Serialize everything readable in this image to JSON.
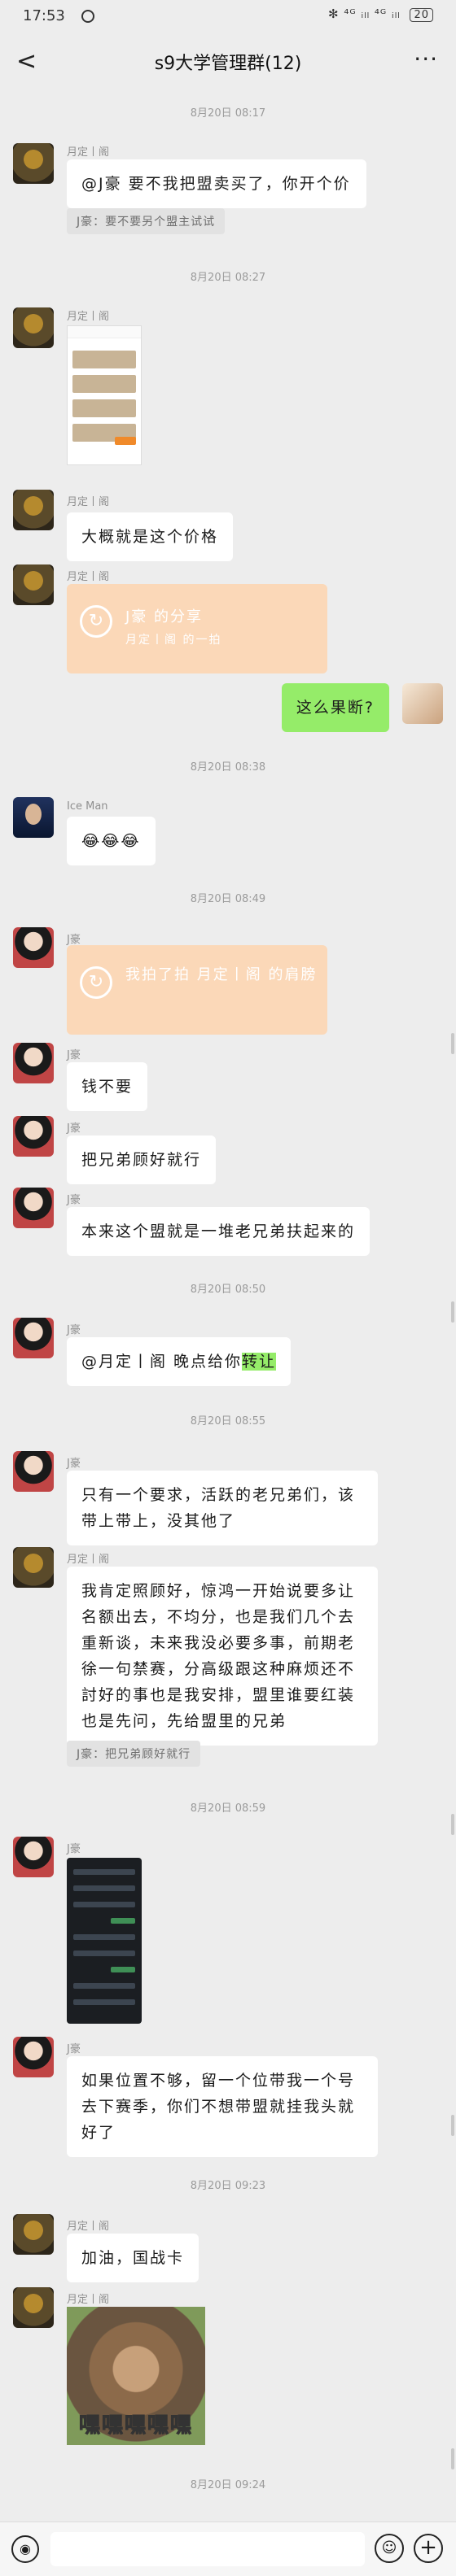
{
  "status": {
    "time": "17:53",
    "indicators": "✻ ⁴ᴳ ᵢₗₗ ⁴ᴳ ᵢₗₗ",
    "battery": "20"
  },
  "header": {
    "back": "<",
    "title": "s9大学管理群(12)",
    "more": "···"
  },
  "timestamps": [
    "8月20日 08:17",
    "8月20日 08:27",
    "8月20日 08:38",
    "8月20日 08:49",
    "8月20日 08:50",
    "8月20日 08:55",
    "8月20日 08:59",
    "8月20日 09:23",
    "8月20日 09:24"
  ],
  "messages": {
    "m1": {
      "nick": "月定丨阁",
      "text": "@J豪 要不我把盟卖买了，你开个价",
      "quote": "J豪：要不要另个盟主试试"
    },
    "m2": {
      "nick": "月定丨阁"
    },
    "m3": {
      "nick": "月定丨阁",
      "text": "大概就是这个价格"
    },
    "m4": {
      "nick": "月定丨阁",
      "card_title": "J豪 的分享",
      "card_sub": "月定丨阁 的一拍"
    },
    "m5": {
      "text": "这么果断?"
    },
    "m6": {
      "nick": "Ice Man",
      "text": "😂😂😂"
    },
    "m7": {
      "nick": "J豪",
      "card_title": "我拍了拍 月定丨阁 的肩膀"
    },
    "m8": {
      "nick": "J豪",
      "text": "钱不要"
    },
    "m9": {
      "nick": "J豪",
      "text": "把兄弟顾好就行"
    },
    "m10": {
      "nick": "J豪",
      "text": "本来这个盟就是一堆老兄弟扶起来的"
    },
    "m11": {
      "nick": "J豪",
      "text_a": "@月定丨阁 晚点给你",
      "text_b": "转让"
    },
    "m12": {
      "nick": "J豪",
      "text": "只有一个要求，活跃的老兄弟们，该带上带上，没其他了"
    },
    "m13": {
      "nick": "月定丨阁",
      "text": "我肯定照顾好，惊鸿一开始说要多让名额出去，不均分，也是我们几个去重新谈，未来我没必要多事，前期老徐一句禁赛，分高级跟这种麻烦还不討好的事也是我安排，盟里谁要红装也是先问，先给盟里的兄弟",
      "quote": "J豪：把兄弟顾好就行"
    },
    "m14": {
      "nick": "J豪"
    },
    "m15": {
      "nick": "J豪",
      "text": "如果位置不够，留一个位带我一个号去下赛季，你们不想带盟就挂我头就好了"
    },
    "m16": {
      "nick": "月定丨阁",
      "text": "加油，国战卡"
    },
    "m17": {
      "nick": "月定丨阁",
      "sticker_text": "嘿嘿嘿嘿嘿"
    }
  }
}
